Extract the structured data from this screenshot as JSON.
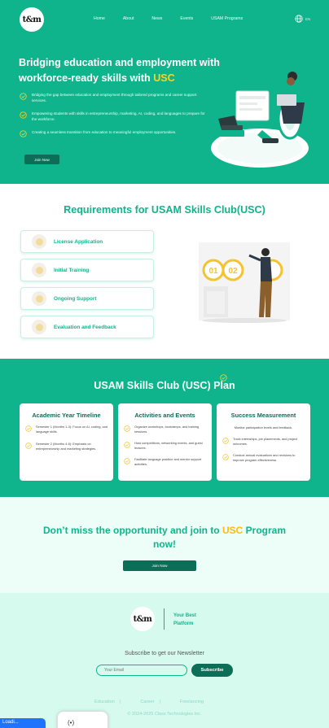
{
  "nav": {
    "logo": "t&m",
    "links": [
      "Home",
      "About",
      "News",
      "Events",
      "USAM Programs"
    ],
    "lang": "EN"
  },
  "hero": {
    "title_main": "Bridging education and employment with workforce-ready skills with ",
    "title_highlight": "USC",
    "bullets": [
      "Bridging the gap between education and employment through tailored programs and career support services.",
      "Empowering students with skills in entrepreneurship, marketing, AI, coding, and languages to prepare for the workforce.",
      "Creating a seamless transition from education to meaningful employment opportunities."
    ],
    "join_label": "Join Now"
  },
  "requirements": {
    "title": "Requirements for USAM Skills Club(USC)",
    "items": [
      "License Application",
      "Initial Training",
      "Ongoing Support",
      "Evaluation and Feedback"
    ]
  },
  "plan": {
    "title": "USAM Skills Club (USC) Plan",
    "cards": [
      {
        "title": "Academic Year Timeline",
        "items": [
          "Semester 1 (Months 1-3): Focus on AI, coding, and language skills.",
          "Semester 2 (Months 4-6): Emphasis on entrepreneurship and marketing strategies."
        ]
      },
      {
        "title": "Activities and Events",
        "items": [
          "Organize workshops, bootcamps, and training sessions.",
          "Host competitions, networking events, and guest lectures.",
          "Facilitate language practice and mentor support activities."
        ]
      },
      {
        "title": "Success Measurement",
        "intro": "Monitor participation levels and feedback.",
        "items": [
          "Track internships, job placements, and project outcomes.",
          "Conduct annual evaluations and revisions to improve program effectiveness."
        ]
      }
    ]
  },
  "cta": {
    "title_before": "Don’t miss the opportunity and join to ",
    "title_highlight": "USC",
    "title_after": " Program now!",
    "button": "Join Now"
  },
  "footer": {
    "logo": "t&m",
    "tagline_line1": "Your Best",
    "tagline_line2": "Platform",
    "newsletter": "Subscribe to get our Newsletter",
    "email_placeholder": "Your Email",
    "subscribe": "Subscribe",
    "links": [
      "Education",
      "Career",
      "Freelancing"
    ],
    "copyright": "© 2024-2025 Class Technologies Inc."
  },
  "overlay": {
    "left_text": "Loadi...",
    "mid_text": "(•)"
  },
  "colors": {
    "brand": "#10b48c",
    "dark": "#0c6e56",
    "accent": "#ffd21a"
  }
}
